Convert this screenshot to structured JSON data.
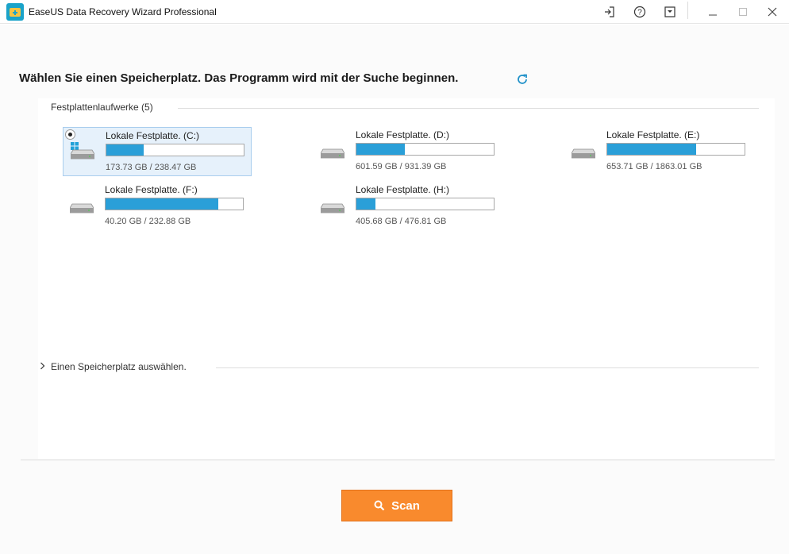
{
  "window": {
    "title": "EaseUS Data Recovery Wizard Professional"
  },
  "main": {
    "heading": "Wählen Sie einen Speicherplatz. Das Programm wird mit der Suche beginnen.",
    "section_drives": "Festplattenlaufwerke (5)",
    "drives": [
      {
        "name": "Lokale Festplatte. (C:)",
        "size": "173.73 GB / 238.47 GB",
        "fill": 0.27,
        "selected": true,
        "system": true
      },
      {
        "name": "Lokale Festplatte. (D:)",
        "size": "601.59 GB / 931.39 GB",
        "fill": 0.35,
        "selected": false,
        "system": false
      },
      {
        "name": "Lokale Festplatte. (E:)",
        "size": "653.71 GB / 1863.01 GB",
        "fill": 0.65,
        "selected": false,
        "system": false
      },
      {
        "name": "Lokale Festplatte. (F:)",
        "size": "40.20 GB / 232.88 GB",
        "fill": 0.82,
        "selected": false,
        "system": false
      },
      {
        "name": "Lokale Festplatte. (H:)",
        "size": "405.68 GB / 476.81 GB",
        "fill": 0.14,
        "selected": false,
        "system": false
      }
    ],
    "section_location": "Einen Speicherplatz auswählen.",
    "scan_label": "Scan"
  },
  "colors": {
    "accent": "#2a9fd8",
    "scan_button": "#f98a2d",
    "selected_bg": "#e6f1fb"
  },
  "icons": [
    "app-logo-icon",
    "login-icon",
    "help-icon",
    "menu-dropdown-icon",
    "minimize-icon",
    "maximize-icon",
    "close-icon",
    "refresh-icon",
    "hard-drive-icon",
    "windows-logo-icon",
    "chevron-right-icon",
    "search-icon"
  ]
}
